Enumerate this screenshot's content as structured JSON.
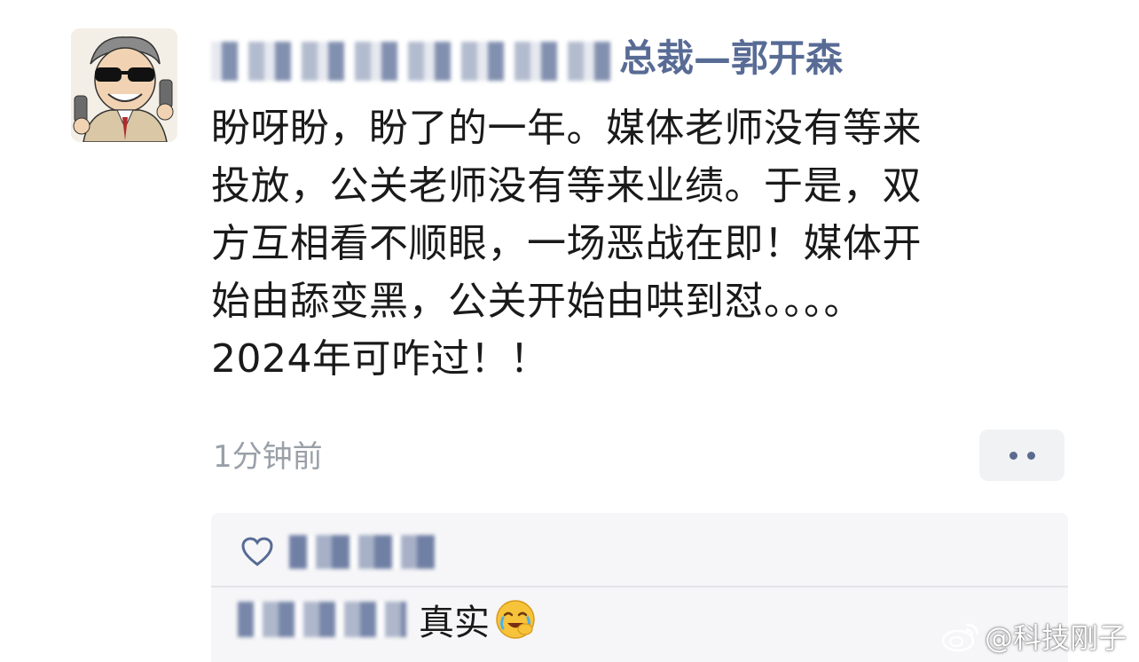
{
  "post": {
    "author_name_visible": "总裁—郭开森",
    "body_lines": [
      "盼呀盼，盼了的一年。媒体老师没有等来",
      "投放，公关老师没有等来业绩。于是，双",
      "方互相看不顺眼，一场恶战在即！媒体开",
      "始由舔变黑，公关开始由哄到怼。。。。",
      "2024年可咋过！！"
    ],
    "timestamp": "1分钟前"
  },
  "comments": {
    "reply_text": "真实"
  },
  "watermark": {
    "text": "@科技刚子"
  },
  "icons": {
    "avatar": "cartoon-avatar",
    "more": "more-dots-icon",
    "like": "heart-outline-icon",
    "emoji": "facepalm-cry-emoji",
    "weibo": "weibo-logo-icon"
  },
  "colors": {
    "name_link": "#586b95",
    "text": "#1a1a1a",
    "muted": "#9aa0a8",
    "comment_bg": "#f6f6f8",
    "button_bg": "#f1f2f4"
  }
}
